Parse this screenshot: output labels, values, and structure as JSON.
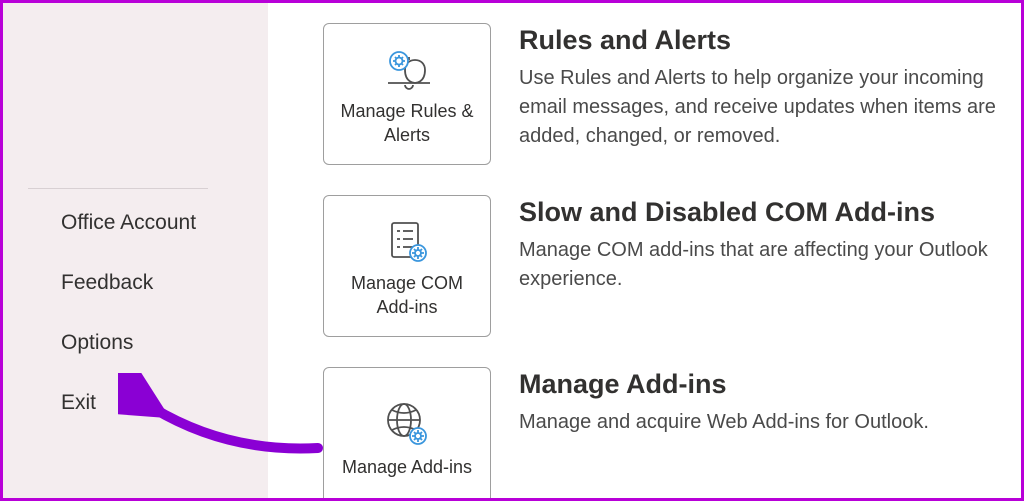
{
  "sidebar": {
    "items": [
      {
        "label": "Office Account"
      },
      {
        "label": "Feedback"
      },
      {
        "label": "Options"
      },
      {
        "label": "Exit"
      }
    ]
  },
  "main": {
    "sections": [
      {
        "tile_label": "Manage Rules & Alerts",
        "title": "Rules and Alerts",
        "text": "Use Rules and Alerts to help organize your incoming email messages, and receive updates when items are added, changed, or removed."
      },
      {
        "tile_label": "Manage COM Add-ins",
        "title": "Slow and Disabled COM Add-ins",
        "text": "Manage COM add-ins that are affecting your Outlook experience."
      },
      {
        "tile_label": "Manage Add-ins",
        "title": "Manage Add-ins",
        "text": "Manage and acquire Web Add-ins for Outlook."
      }
    ]
  }
}
